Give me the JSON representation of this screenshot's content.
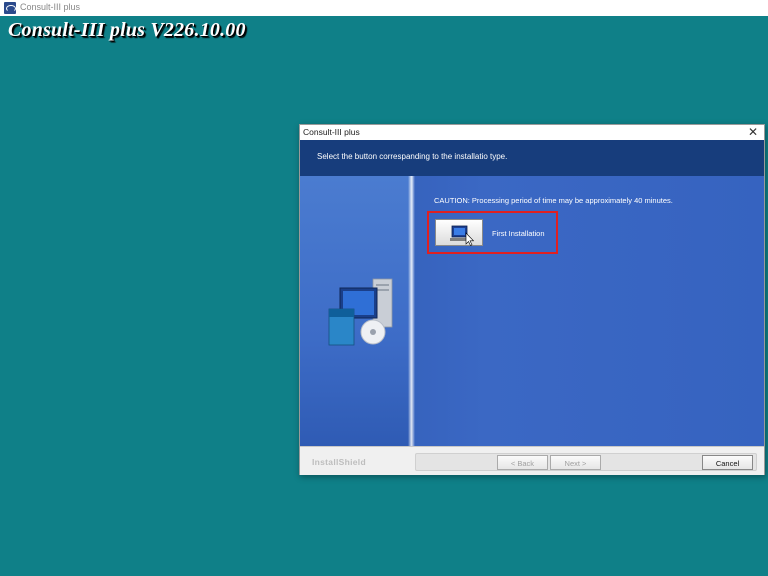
{
  "window": {
    "title": "Consult-III plus"
  },
  "background": {
    "title": "Consult-III plus V226.10.00"
  },
  "dialog": {
    "title": "Consult-III plus",
    "instruction": "Select the button correspanding to the installatio  type.",
    "caution": "CAUTION: Processing period of time may be approximately 40 minutes.",
    "first_installation_label": "First Installation",
    "footer_brand": "InstallShield",
    "buttons": {
      "back": "< Back",
      "next": "Next >",
      "cancel": "Cancel"
    }
  },
  "icons": [
    "app-icon",
    "close-icon",
    "computer-cd-graphic",
    "computer-monitor-icon",
    "mouse-cursor-icon"
  ],
  "colors": {
    "desktop": "#0f8088",
    "header": "#173d7c",
    "body": "#3663c0",
    "highlight": "#e02020"
  }
}
